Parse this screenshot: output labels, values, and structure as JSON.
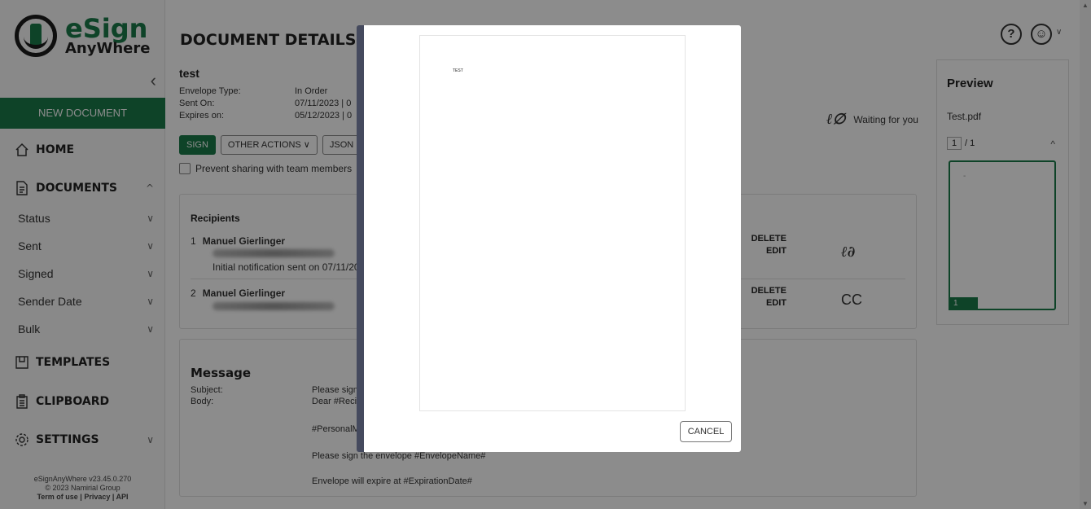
{
  "brand": {
    "name_line1": "eSign",
    "name_line2": "AnyWhere"
  },
  "sidebar": {
    "collapse_glyph": "‹",
    "new_document": "NEW DOCUMENT",
    "home": "HOME",
    "documents": "DOCUMENTS",
    "doc_items": [
      "Status",
      "Sent",
      "Signed",
      "Sender Date",
      "Bulk"
    ],
    "templates": "TEMPLATES",
    "clipboard": "CLIPBOARD",
    "settings": "SETTINGS",
    "footer": {
      "version": "eSignAnyWhere v23.45.0.270",
      "copyright": "© 2023 Namirial Group",
      "links": "Term of use | Privacy | API"
    }
  },
  "header": {
    "title": "DOCUMENT DETAILS",
    "help_glyph": "?"
  },
  "document": {
    "name": "test",
    "envelope_type_label": "Envelope Type:",
    "envelope_type_value": "In Order",
    "sent_on_label": "Sent On:",
    "sent_on_value": "07/11/2023 | 0",
    "expires_on_label": "Expires on:",
    "expires_on_value": "05/12/2023 | 0",
    "buttons": {
      "sign": "SIGN",
      "other_actions": "OTHER ACTIONS ∨",
      "json": "JSON"
    },
    "prevent_sharing": "Prevent sharing with team members",
    "status": "Waiting for you"
  },
  "recipients": {
    "title": "Recipients",
    "list": [
      {
        "index": "1",
        "name": "Manuel Gierlinger",
        "note": "Initial notification sent on 07/11/20",
        "delete": "DELETE",
        "edit": "EDIT",
        "type": "sign"
      },
      {
        "index": "2",
        "name": "Manuel Gierlinger",
        "delete": "DELETE",
        "edit": "EDIT",
        "type": "CC"
      }
    ]
  },
  "message": {
    "title": "Message",
    "subject_label": "Subject:",
    "subject_value": "Please sign",
    "body_label": "Body:",
    "body_lines": [
      "Dear #Reci",
      "#PersonalM",
      "Please sign the envelope #EnvelopeName#",
      "Envelope will expire at #ExpirationDate#"
    ]
  },
  "preview": {
    "title": "Preview",
    "file": "Test.pdf",
    "page_current": "1",
    "page_total": "/ 1",
    "thumb_page": "1",
    "thumb_mark": "-"
  },
  "modal": {
    "page_text": "TEST",
    "cancel": "CANCEL"
  }
}
